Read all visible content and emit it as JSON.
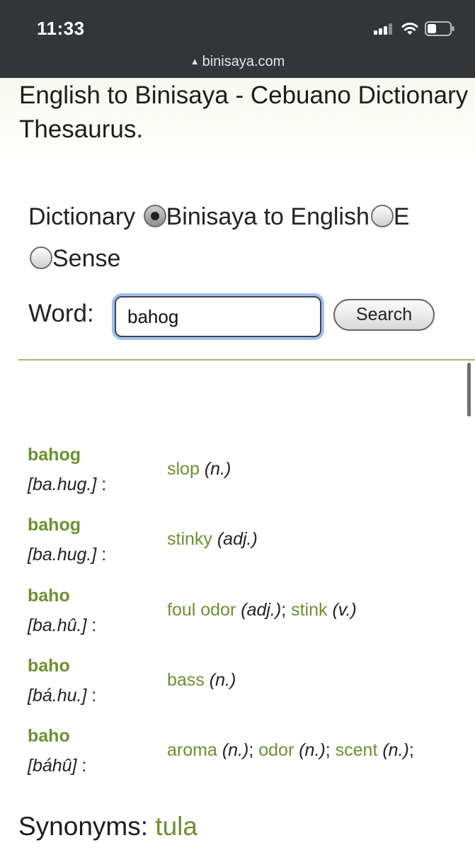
{
  "status_bar": {
    "time": "11:33",
    "url": "binisaya.com"
  },
  "page": {
    "heading": "English to Binisaya - Cebuano Dictionary and Thesaurus.",
    "dictionary_label": "Dictionary",
    "options": [
      {
        "label": "Binisaya to English",
        "checked": true
      },
      {
        "label": "E",
        "checked": false
      },
      {
        "label": "Sense",
        "checked": false
      }
    ],
    "word_label": "Word:",
    "word_value": "bahog",
    "search_button": "Search",
    "entries": [
      {
        "word": "bahog",
        "pron": "[ba.hug.]",
        "defs": [
          {
            "term": "slop",
            "pos": "(n.)"
          }
        ]
      },
      {
        "word": "bahog",
        "pron": "[ba.hug.]",
        "defs": [
          {
            "term": "stinky",
            "pos": "(adj.)"
          }
        ]
      },
      {
        "word": "baho",
        "pron": "[ba.hû.]",
        "defs": [
          {
            "term": "foul odor",
            "pos": "(adj.)"
          },
          {
            "term": "stink",
            "pos": "(v.)"
          }
        ]
      },
      {
        "word": "baho",
        "pron": "[bá.hu.]",
        "defs": [
          {
            "term": "bass",
            "pos": "(n.)"
          }
        ]
      },
      {
        "word": "baho",
        "pron": "[báhû]",
        "defs": [
          {
            "term": "aroma",
            "pos": "(n.)"
          },
          {
            "term": "odor",
            "pos": "(n.)"
          },
          {
            "term": "scent",
            "pos": "(n.)"
          }
        ]
      }
    ],
    "synonyms_label": "Synonyms:",
    "synonyms_link": "tula",
    "colon": ":",
    "separator": ";"
  }
}
